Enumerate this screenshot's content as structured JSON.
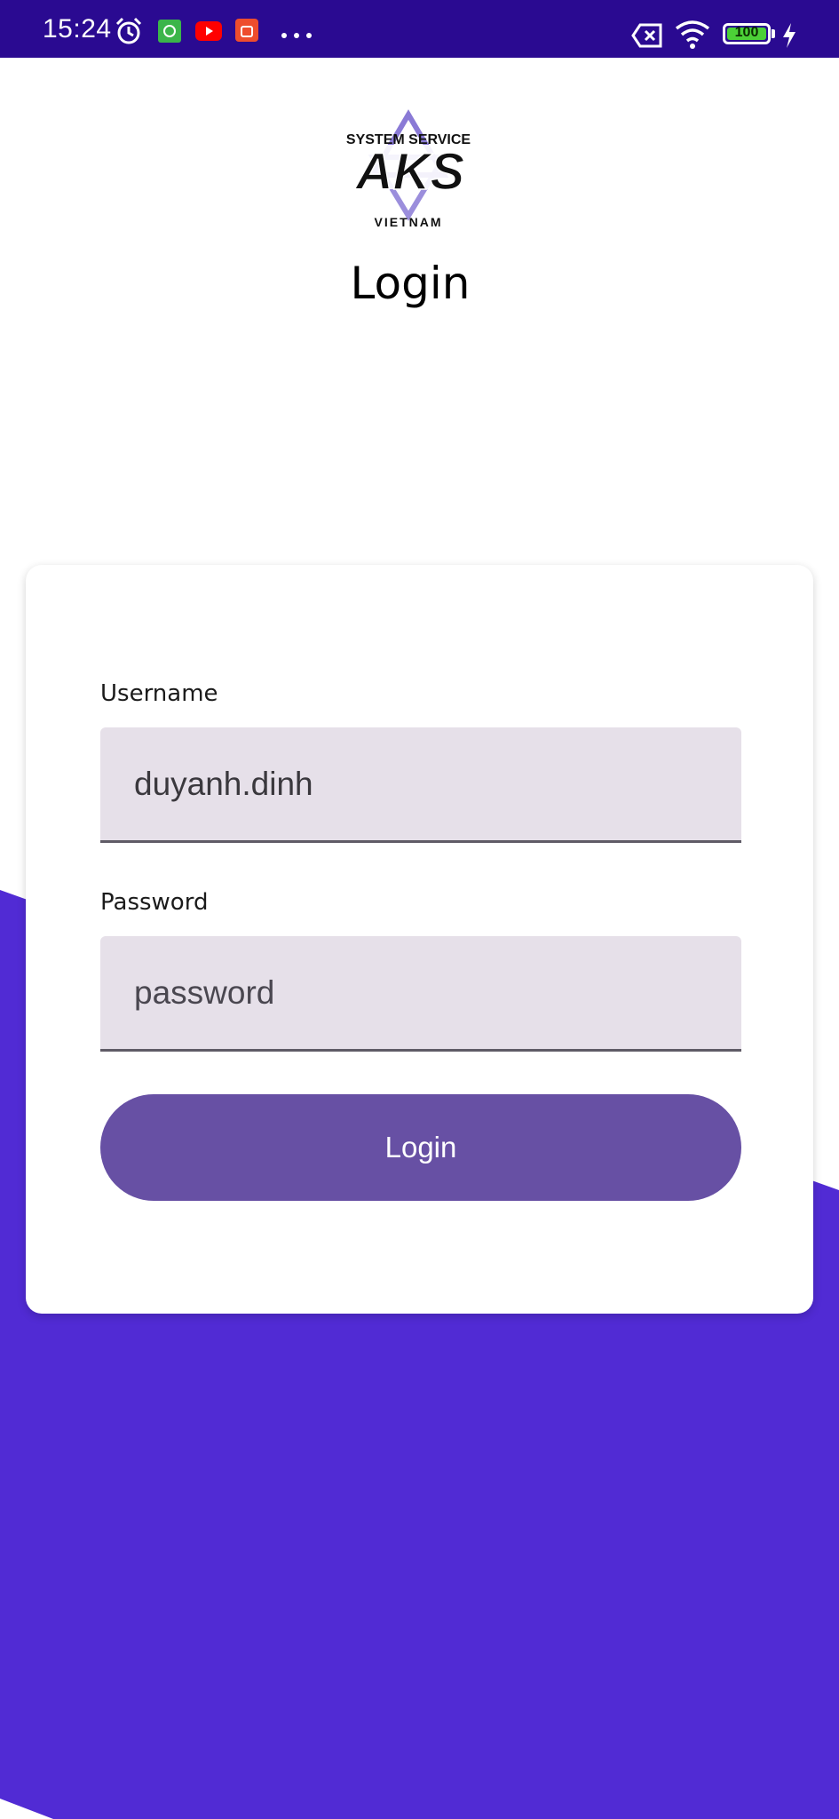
{
  "status_bar": {
    "time": "15:24",
    "battery": "100",
    "icons": [
      "alarm-icon",
      "android-app-icon",
      "youtube-icon",
      "shop-app-icon",
      "more-dots-icon",
      "no-sim-icon",
      "wifi-icon",
      "battery-icon",
      "charging-icon"
    ]
  },
  "header": {
    "logo_text_top": "SYSTEM SERVICE",
    "logo_text_main": "AKS",
    "logo_text_bottom": "VIETNAM",
    "title": "Login"
  },
  "form": {
    "username_label": "Username",
    "username_value": "duyanh.dinh",
    "password_label": "Password",
    "password_placeholder": "password",
    "submit_label": "Login"
  },
  "colors": {
    "status_bar": "#2a0a91",
    "background_wave": "#512bd4",
    "field_fill": "#e6e0e9",
    "button": "#6750a4"
  }
}
